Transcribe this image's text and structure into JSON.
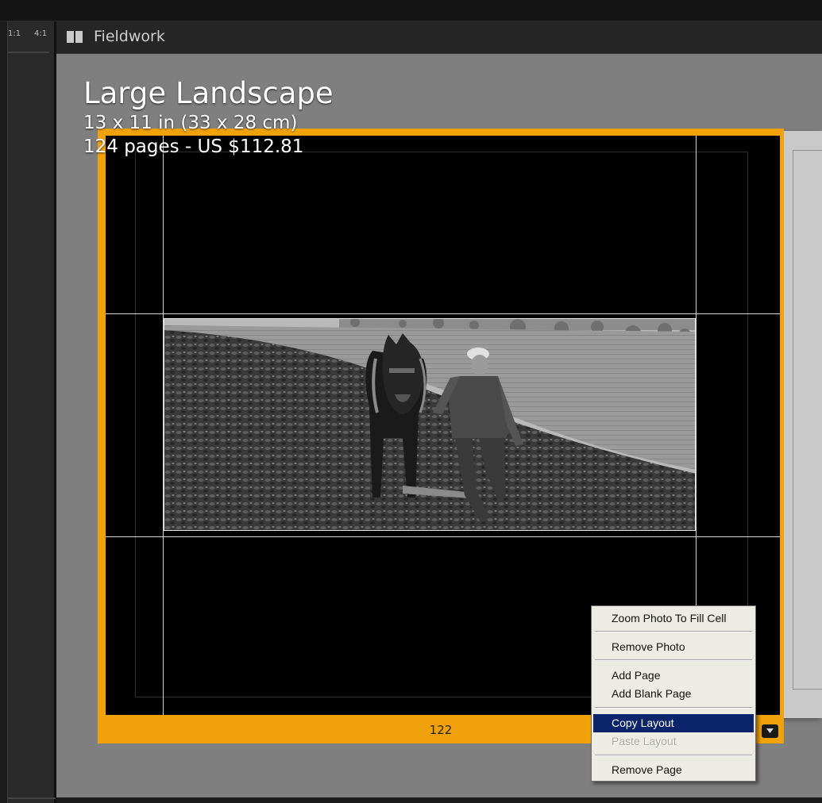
{
  "zoom_presets": [
    "1:1",
    "4:1"
  ],
  "header": {
    "title": "Fieldwork"
  },
  "book_info": {
    "type": "Large Landscape",
    "size": "13 x 11 in (33 x 28 cm)",
    "pages_price": "124 pages - US $112.81"
  },
  "page": {
    "number": "122"
  },
  "context_menu": {
    "items": [
      {
        "label": "Zoom Photo To Fill Cell",
        "enabled": true,
        "selected": false
      },
      {
        "label": "Remove Photo",
        "enabled": true,
        "selected": false
      },
      {
        "label": "Add Page",
        "enabled": true,
        "selected": false
      },
      {
        "label": "Add Blank Page",
        "enabled": true,
        "selected": false
      },
      {
        "label": "Copy Layout",
        "enabled": true,
        "selected": true
      },
      {
        "label": "Paste Layout",
        "enabled": false,
        "selected": false
      },
      {
        "label": "Remove Page",
        "enabled": true,
        "selected": false
      }
    ]
  },
  "colors": {
    "selected_page_highlight": "#f1a20a",
    "menu_selection": "#0b246b",
    "canvas_background": "#7f7f7f"
  },
  "icons": [
    "book-view-icon",
    "page-menu-arrow-icon"
  ]
}
